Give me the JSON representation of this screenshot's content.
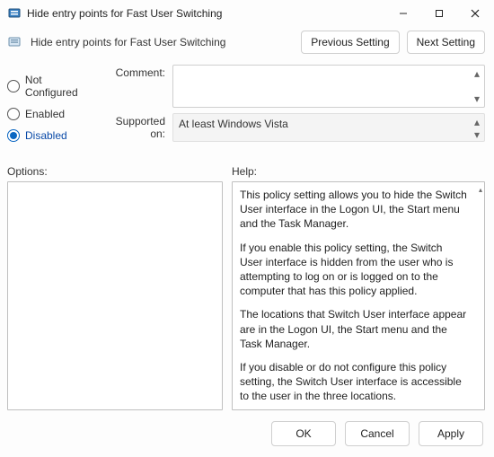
{
  "window": {
    "title": "Hide entry points for Fast User Switching"
  },
  "header": {
    "policy_title": "Hide entry points for Fast User Switching",
    "prev_label": "Previous Setting",
    "next_label": "Next Setting"
  },
  "radios": {
    "not_configured": "Not Configured",
    "enabled": "Enabled",
    "disabled": "Disabled",
    "selected": "disabled"
  },
  "meta": {
    "comment_label": "Comment:",
    "comment_value": "",
    "supported_label": "Supported on:",
    "supported_value": "At least Windows Vista"
  },
  "panes": {
    "options_label": "Options:",
    "help_label": "Help:",
    "help_p1": "This policy setting allows you to hide the Switch User interface in the Logon UI, the Start menu and the Task Manager.",
    "help_p2": "If you enable this policy setting, the Switch User interface is hidden from the user who is attempting to log on or is logged on to the computer that has this policy applied.",
    "help_p3": "The locations that Switch User interface appear are in the Logon UI, the Start menu and the Task Manager.",
    "help_p4": "If you disable or do not configure this policy setting, the Switch User interface is accessible to the user in the three locations."
  },
  "footer": {
    "ok": "OK",
    "cancel": "Cancel",
    "apply": "Apply"
  }
}
